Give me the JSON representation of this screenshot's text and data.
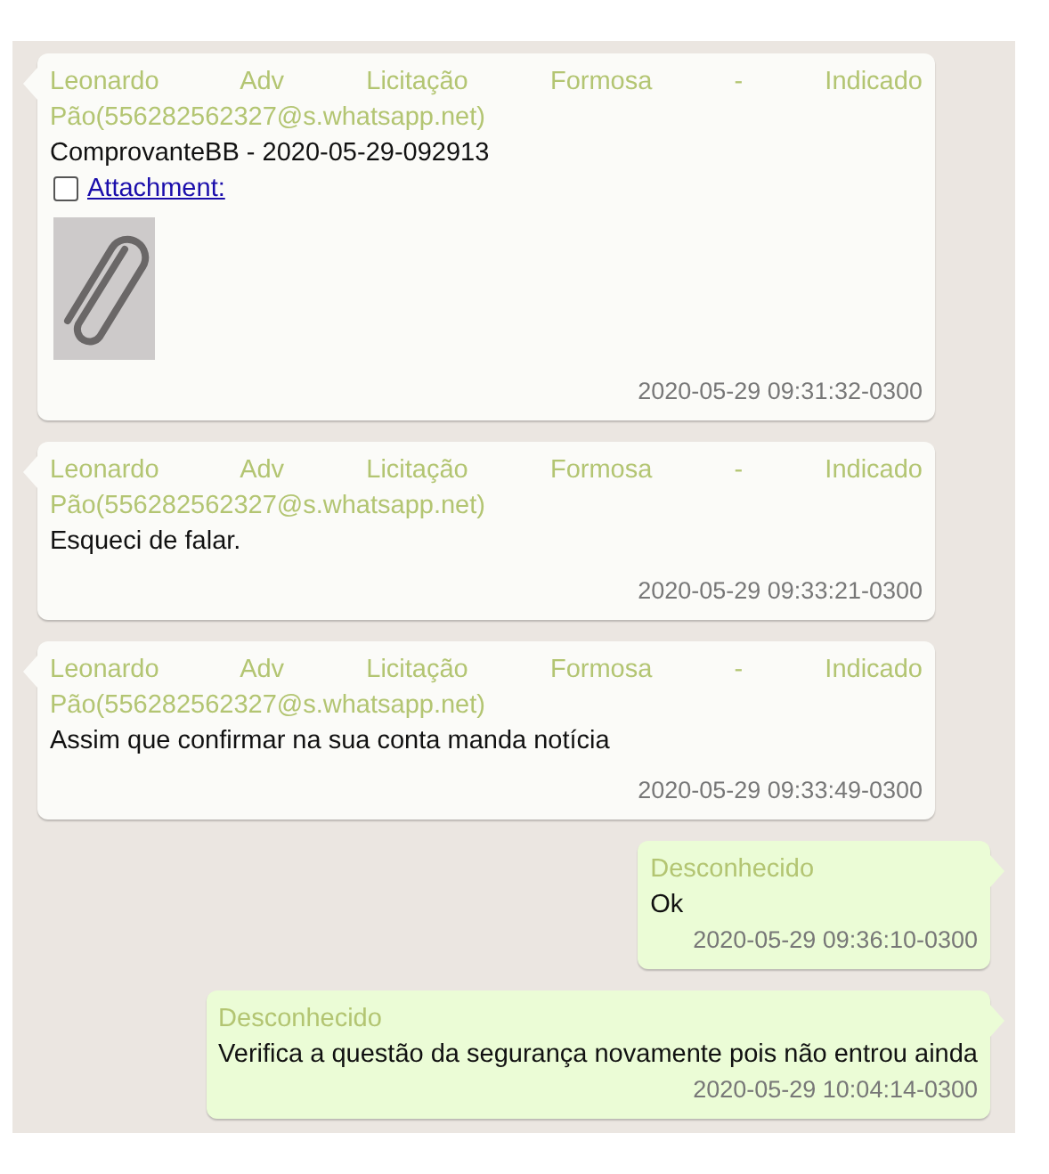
{
  "messages": [
    {
      "kind": "incoming",
      "sender": "Leonardo Adv Licitação Formosa - Indicado Pão(556282562327@s.whatsapp.net)",
      "text": "ComprovanteBB - 2020-05-29-092913",
      "attachment": {
        "checked": false,
        "label": "Attachment:"
      },
      "time": "2020-05-29 09:31:32-0300"
    },
    {
      "kind": "incoming",
      "sender": "Leonardo Adv Licitação Formosa - Indicado Pão(556282562327@s.whatsapp.net)",
      "text": "Esqueci de falar.",
      "time": "2020-05-29 09:33:21-0300"
    },
    {
      "kind": "incoming",
      "sender": "Leonardo Adv Licitação Formosa - Indicado Pão(556282562327@s.whatsapp.net)",
      "text": "Assim que confirmar na sua conta manda notícia",
      "time": "2020-05-29 09:33:49-0300"
    },
    {
      "kind": "outgoing",
      "sender": "Desconhecido",
      "text": "Ok",
      "time": "2020-05-29 09:36:10-0300"
    },
    {
      "kind": "outgoing",
      "sender": "Desconhecido",
      "text": "Verifica a questão da segurança novamente pois não entrou ainda",
      "time": "2020-05-29 10:04:14-0300"
    }
  ]
}
